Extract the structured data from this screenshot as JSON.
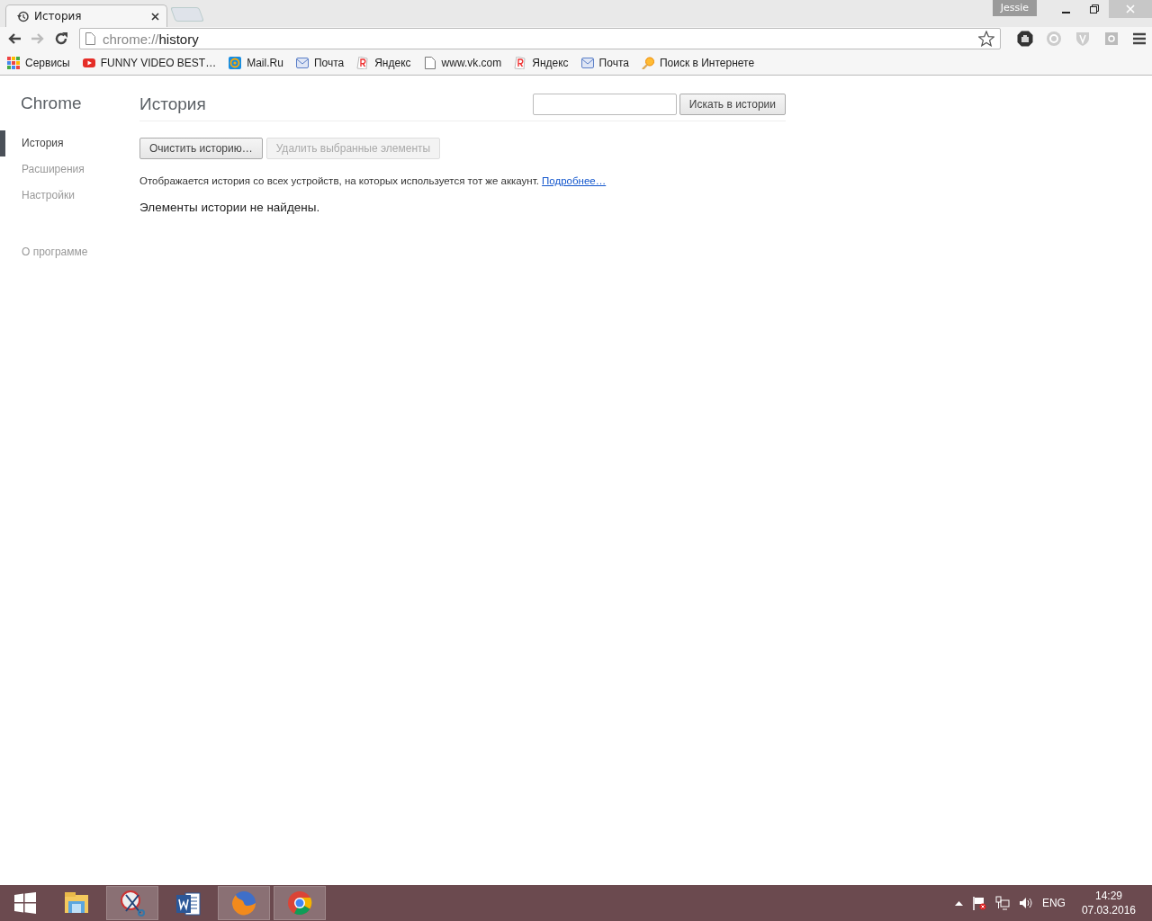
{
  "tabs": [
    {
      "title": "История",
      "selected": true
    }
  ],
  "profile": "Jessie",
  "address": {
    "scheme": "chrome://",
    "path": "history"
  },
  "bookmarks": [
    {
      "label": "Сервисы",
      "kind": "apps"
    },
    {
      "label": "FUNNY VIDEO BEST…",
      "kind": "video"
    },
    {
      "label": "Mail.Ru",
      "kind": "at"
    },
    {
      "label": "Почта",
      "kind": "mail"
    },
    {
      "label": "Яндекс",
      "kind": "yandex"
    },
    {
      "label": "www.vk.com",
      "kind": "page"
    },
    {
      "label": "Яндекс",
      "kind": "yandex"
    },
    {
      "label": "Почта",
      "kind": "mail"
    },
    {
      "label": "Поиск в Интернете",
      "kind": "search"
    }
  ],
  "sidebar": {
    "title": "Chrome",
    "items": [
      {
        "label": "История",
        "selected": true
      },
      {
        "label": "Расширения",
        "selected": false
      },
      {
        "label": "Настройки",
        "selected": false
      }
    ],
    "about": "О программе"
  },
  "page": {
    "title": "История",
    "search_button": "Искать в истории",
    "buttons": [
      {
        "label": "Очистить историю…",
        "disabled": false
      },
      {
        "label": "Удалить выбранные элементы",
        "disabled": true
      }
    ],
    "notice": "Отображается история со всех устройств, на которых используется тот же аккаунт.",
    "notice_link": "Подробнее…",
    "empty": "Элементы истории не найдены."
  },
  "taskbar": {
    "apps": [
      {
        "kind": "folder",
        "active": false
      },
      {
        "kind": "scissors",
        "active": true
      },
      {
        "kind": "word",
        "active": false
      },
      {
        "kind": "firefox",
        "active": true
      },
      {
        "kind": "chrome",
        "active": true
      }
    ]
  },
  "tray": {
    "language": "ENG",
    "time": "14:29",
    "date": "07.03.2016"
  }
}
